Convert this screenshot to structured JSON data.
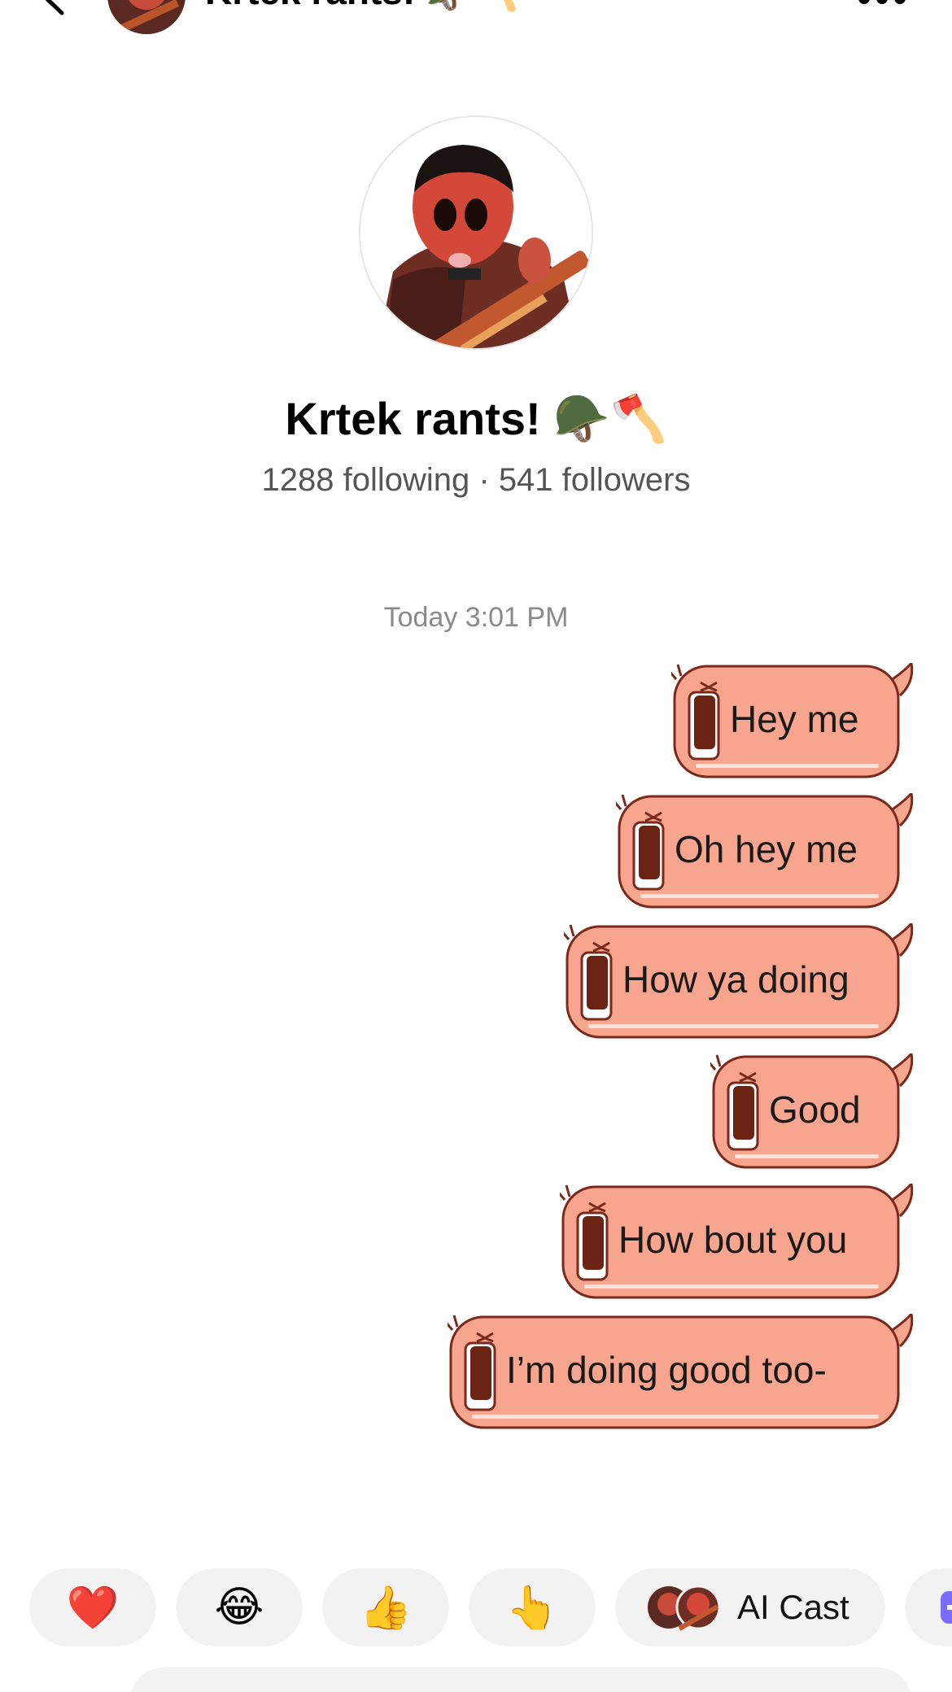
{
  "header": {
    "title": "Krtek rants!",
    "title_emoji": "🪖🪓",
    "back_icon": "chevron-left-icon",
    "more_icon": "more-horizontal-icon"
  },
  "profile": {
    "name": "Krtek rants!",
    "name_emoji": "🪖🪓",
    "following": "1288 following",
    "separator": "·",
    "followers": "541 followers"
  },
  "conversation": {
    "timestamp": "Today 3:01 PM",
    "bubble_color": "#F7A58E",
    "bubble_outline": "#7a2a1a",
    "messages": [
      {
        "text": "Hey me"
      },
      {
        "text": "Oh hey me"
      },
      {
        "text": "How ya doing"
      },
      {
        "text": "Good"
      },
      {
        "text": "How bout you"
      },
      {
        "text": "I’m doing good too-"
      }
    ]
  },
  "quick_reactions": {
    "items": [
      {
        "emoji": "❤️",
        "name": "heart"
      },
      {
        "emoji": "😂",
        "name": "laughing"
      },
      {
        "emoji": "👍",
        "name": "thumbs-up"
      },
      {
        "emoji": "👆",
        "name": "pointing-up"
      }
    ],
    "ai_cast_label": "AI Cast"
  }
}
